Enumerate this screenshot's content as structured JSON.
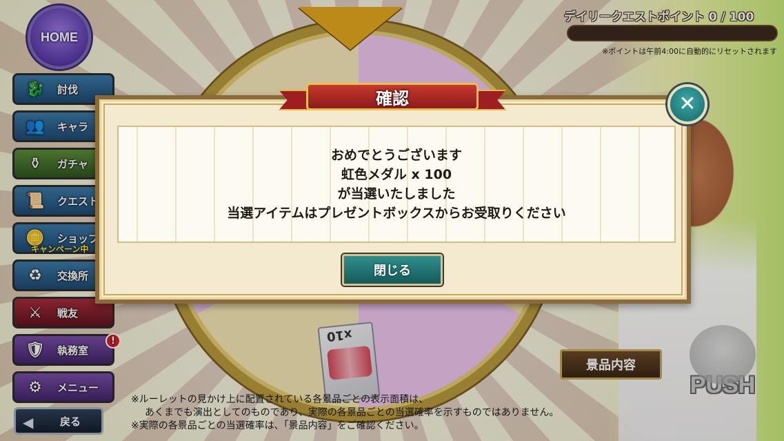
{
  "nav": {
    "home": "HOME",
    "items": [
      {
        "label": "討伐",
        "icon": "dragon-icon",
        "sub": ""
      },
      {
        "label": "キャラ",
        "icon": "characters-icon",
        "sub": ""
      },
      {
        "label": "ガチャ",
        "icon": "pot-icon",
        "sub": ""
      },
      {
        "label": "クエスト",
        "icon": "scroll-icon",
        "sub": ""
      },
      {
        "label": "ショップ",
        "icon": "shop-icon",
        "sub": "キャンペーン中"
      },
      {
        "label": "交換所",
        "icon": "exchange-icon",
        "sub": ""
      },
      {
        "label": "戦友",
        "icon": "swords-icon",
        "sub": ""
      },
      {
        "label": "執務室",
        "icon": "office-icon",
        "sub": ""
      },
      {
        "label": "メニュー",
        "icon": "gear-icon",
        "sub": ""
      }
    ],
    "office_badge": "!",
    "back": "戻る"
  },
  "daily_quest": {
    "label": "デイリークエストポイント 0 / 100",
    "progress": 0,
    "note": "※ポイントは午前4:00に自動的にリセットされます"
  },
  "wheel": {
    "visible_item_qty": "x10"
  },
  "dialog": {
    "title": "確認",
    "lines": [
      "おめでとうございます",
      "虹色メダル x 100",
      "が当選いたしました",
      "当選アイテムはプレゼントボックスからお受取りください"
    ],
    "close_label": "閉じる",
    "x_label": "✕"
  },
  "bottom": {
    "prize_button": "景品内容",
    "push_button": "PUSH",
    "notes": [
      "※ルーレットの見かけ上に配置されている各景品ごとの表示面積は、",
      "あくまでも演出としてのものであり、実際の各景品ごとの当選確率を示すものではありません。",
      "※実際の各景品ごとの当選確率は、「景品内容」をご確認ください。"
    ]
  },
  "colors": {
    "dialog_bg": "#f4ead0",
    "ribbon_red": "#9e1e22",
    "teal_button": "#2f8f8c"
  }
}
